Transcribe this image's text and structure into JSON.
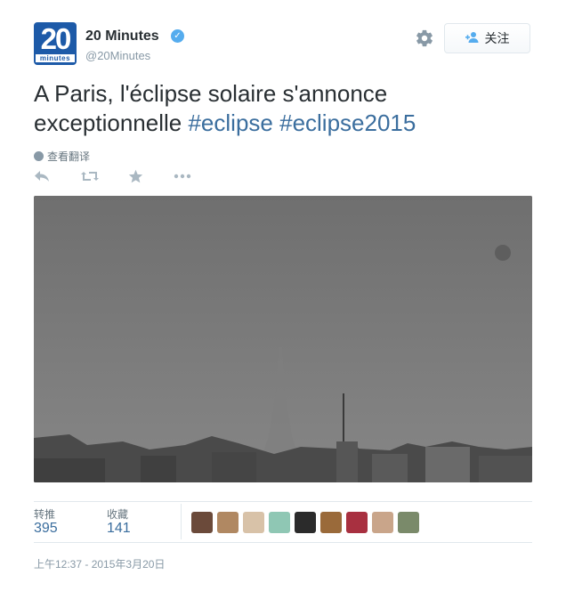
{
  "account": {
    "avatar_big": "20",
    "avatar_small": "minutes",
    "name": "20 Minutes",
    "verified_mark": "✓",
    "handle": "@20Minutes"
  },
  "header": {
    "settings_icon": "gear-icon",
    "follow_label": "关注",
    "follow_icon": "add-user-icon"
  },
  "tweet": {
    "text": "A Paris, l'éclipse solaire s'annonce exceptionnelle",
    "hashtags": [
      "#eclipse",
      "#eclipse2015"
    ],
    "translate_label": "查看翻译"
  },
  "actions": {
    "reply_icon": "reply-icon",
    "retweet_icon": "retweet-icon",
    "favorite_icon": "star-icon",
    "more_icon": "more-icon"
  },
  "stats": {
    "retweets_label": "转推",
    "retweets_value": "395",
    "favorites_label": "收藏",
    "favorites_value": "141"
  },
  "favoriters_count": 9,
  "timestamp": "上午12:37 - 2015年3月20日",
  "colors": {
    "accent": "#55acee",
    "link": "#3b6e9e",
    "text": "#292f33",
    "muted": "#8899a6",
    "avatar_blue": "#1d5aa8"
  }
}
